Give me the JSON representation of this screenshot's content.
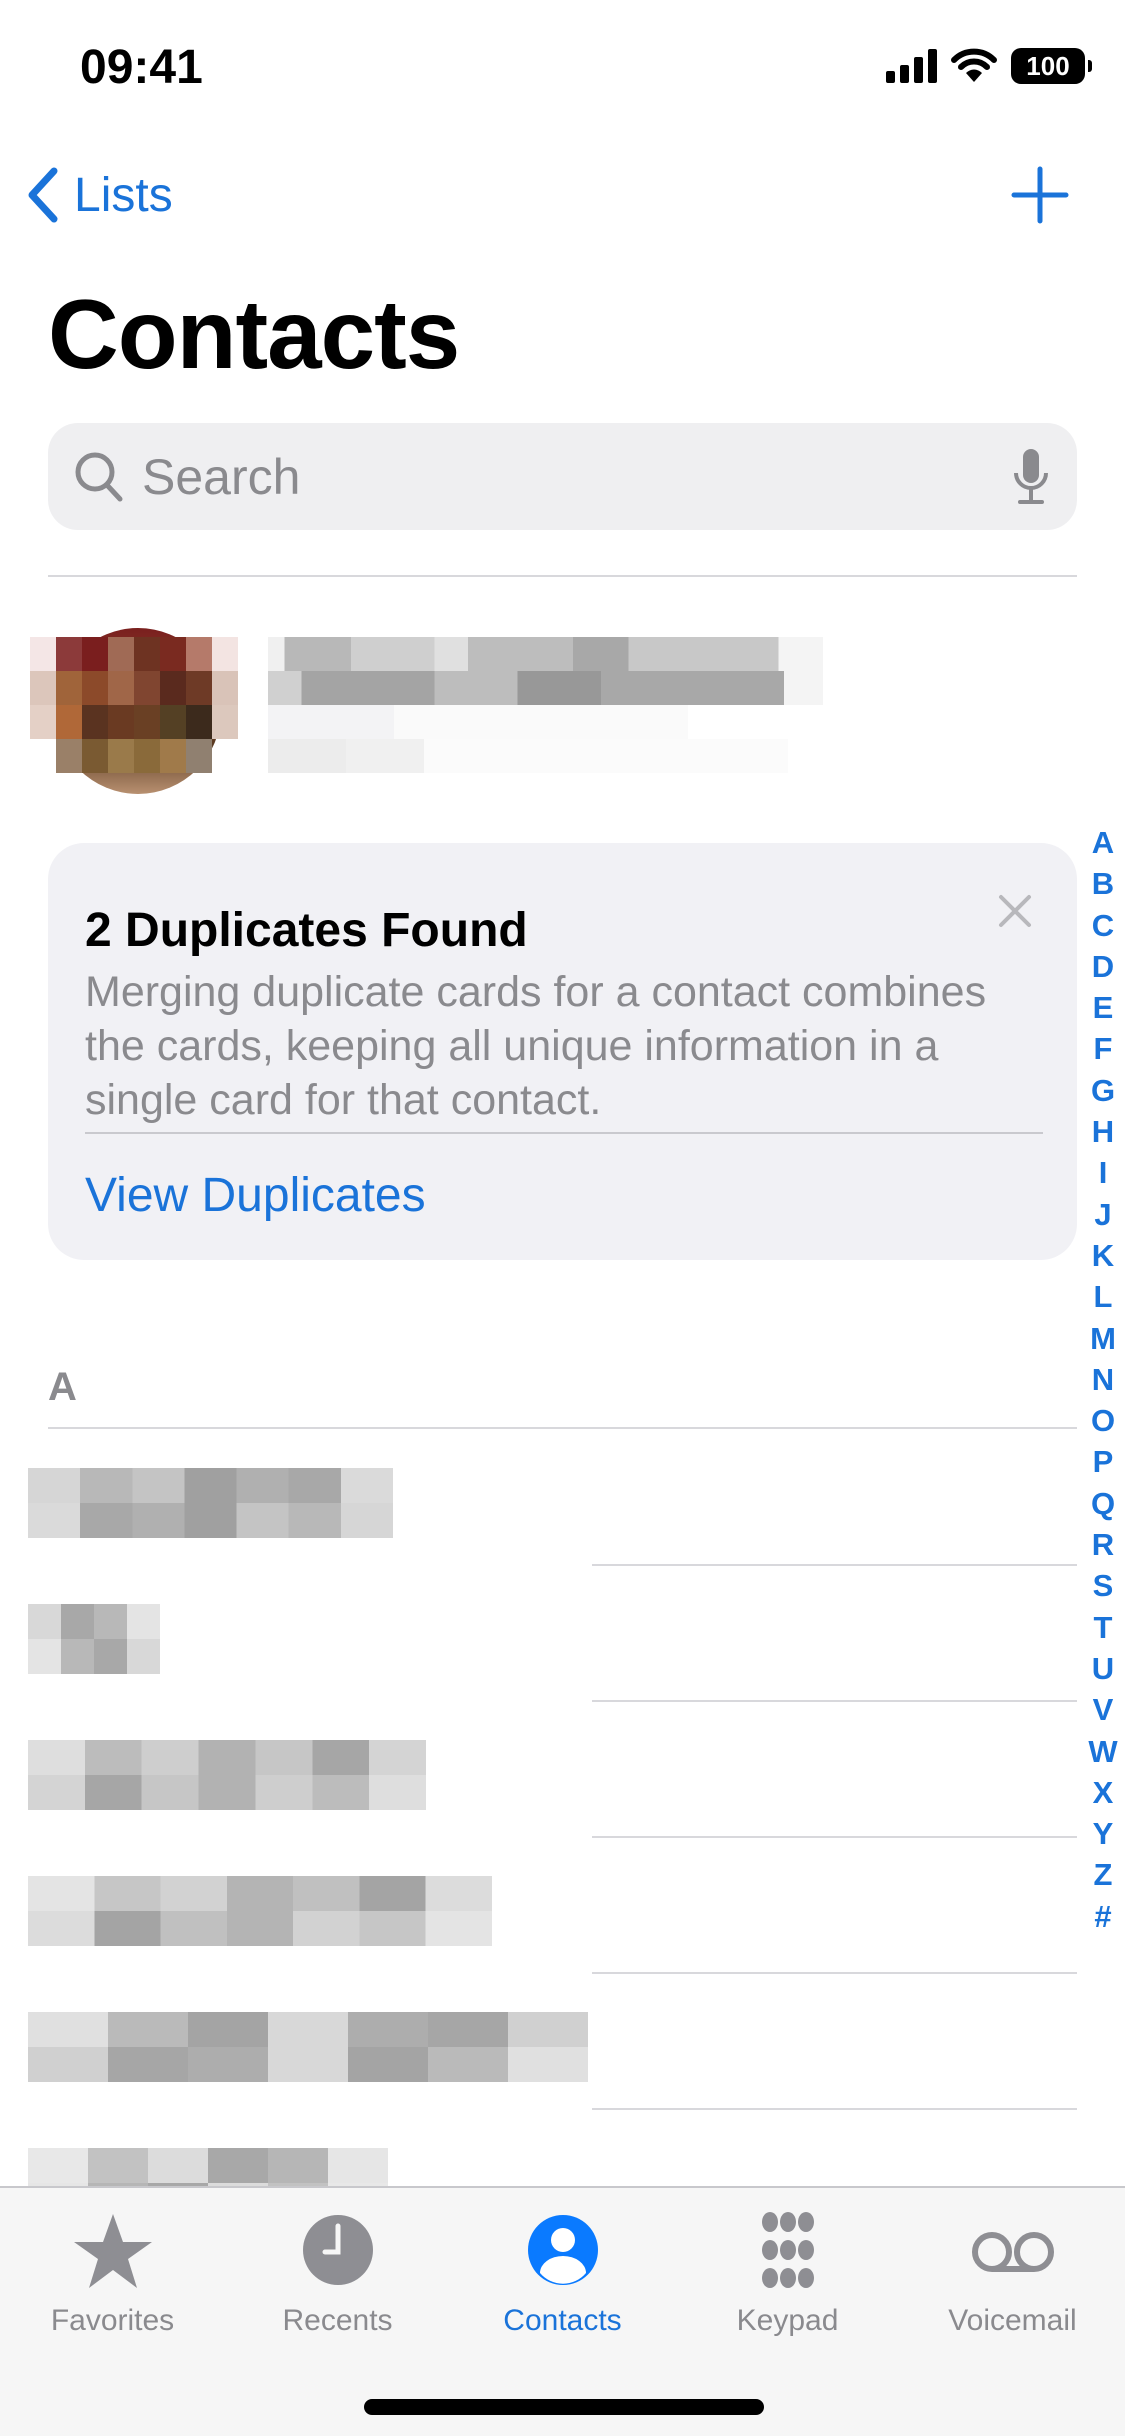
{
  "status_bar": {
    "time": "09:41",
    "battery": "100",
    "icons": [
      "cellular-signal-icon",
      "wifi-icon",
      "battery-icon"
    ]
  },
  "nav": {
    "back_label": "Lists",
    "back_icon": "chevron-left-icon",
    "add_icon": "plus-icon"
  },
  "page_title": "Contacts",
  "search": {
    "placeholder": "Search",
    "value": "",
    "icon": "magnifier-icon",
    "mic_icon": "microphone-icon"
  },
  "my_card": {
    "name": "[pixelated]",
    "subtitle": "[pixelated]",
    "avatar": "pixelated-photo"
  },
  "duplicates_card": {
    "title": "2 Duplicates Found",
    "body": "Merging duplicate cards for a contact combines the cards, keeping all unique information in a single card for that contact.",
    "action_label": "View Duplicates",
    "close_icon": "close-icon"
  },
  "index_letters": [
    "A",
    "B",
    "C",
    "D",
    "E",
    "F",
    "G",
    "H",
    "I",
    "J",
    "K",
    "L",
    "M",
    "N",
    "O",
    "P",
    "Q",
    "R",
    "S",
    "T",
    "U",
    "V",
    "W",
    "X",
    "Y",
    "Z",
    "#"
  ],
  "sections": [
    {
      "header": "A",
      "contacts": [
        {
          "name": "[pixelated]"
        },
        {
          "name": "[pixelated]"
        },
        {
          "name": "[pixelated]"
        },
        {
          "name": "[pixelated]"
        },
        {
          "name": "[pixelated]"
        },
        {
          "name": "[pixelated]"
        }
      ]
    }
  ],
  "tab_bar": {
    "tabs": [
      {
        "label": "Favorites",
        "icon": "star-icon",
        "active": false
      },
      {
        "label": "Recents",
        "icon": "clock-icon",
        "active": false
      },
      {
        "label": "Contacts",
        "icon": "person-circle-icon",
        "active": true
      },
      {
        "label": "Keypad",
        "icon": "keypad-icon",
        "active": false
      },
      {
        "label": "Voicemail",
        "icon": "voicemail-icon",
        "active": false
      }
    ]
  },
  "colors": {
    "accent": "#1a73d9",
    "secondary_text": "#8a8a8e",
    "search_bg": "#efeff1",
    "card_bg": "#f1f1f5",
    "tab_bar_bg": "#f6f6f6"
  }
}
